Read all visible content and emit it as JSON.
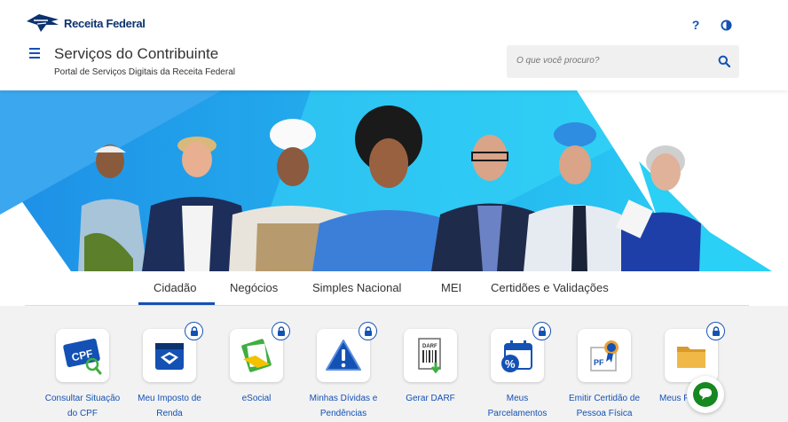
{
  "header": {
    "logo_text": "Receita Federal",
    "help_icon": "help-icon",
    "contrast_icon": "contrast-icon",
    "title": "Serviços do Contribuinte",
    "subtitle": "Portal de Serviços Digitais da Receita Federal"
  },
  "search": {
    "placeholder": "O que você procuro?",
    "value": ""
  },
  "tabs": [
    {
      "label": "Cidadão",
      "active": true
    },
    {
      "label": "Negócios",
      "active": false
    },
    {
      "label": "Simples Nacional",
      "active": false
    },
    {
      "label": "MEI",
      "active": false
    },
    {
      "label": "Certidões e Validações",
      "active": false
    }
  ],
  "services": [
    {
      "label1": "Consultar Situação",
      "label2": "do CPF",
      "icon": "cpf-card-icon",
      "locked": false
    },
    {
      "label1": "Meu Imposto de",
      "label2": "Renda",
      "icon": "income-tax-icon",
      "locked": true
    },
    {
      "label1": "eSocial",
      "label2": "",
      "icon": "esocial-icon",
      "locked": true
    },
    {
      "label1": "Minhas Dívidas e",
      "label2": "Pendências",
      "icon": "warning-icon",
      "locked": true
    },
    {
      "label1": "Gerar DARF",
      "label2": "",
      "icon": "darf-document-icon",
      "locked": false
    },
    {
      "label1": "Meus",
      "label2": "Parcelamentos",
      "icon": "calendar-percent-icon",
      "locked": true
    },
    {
      "label1": "Emitir Certidão de",
      "label2": "Pessoa Física",
      "icon": "certificate-icon",
      "locked": false
    },
    {
      "label1": "Meus F",
      "label2": "",
      "icon": "folder-icon",
      "locked": true
    }
  ],
  "colors": {
    "primary": "#1351b4",
    "navy": "#0c326f",
    "banner_cyan": "#27c2f0",
    "banner_blue": "#1e90e8",
    "chat_green": "#168821"
  }
}
